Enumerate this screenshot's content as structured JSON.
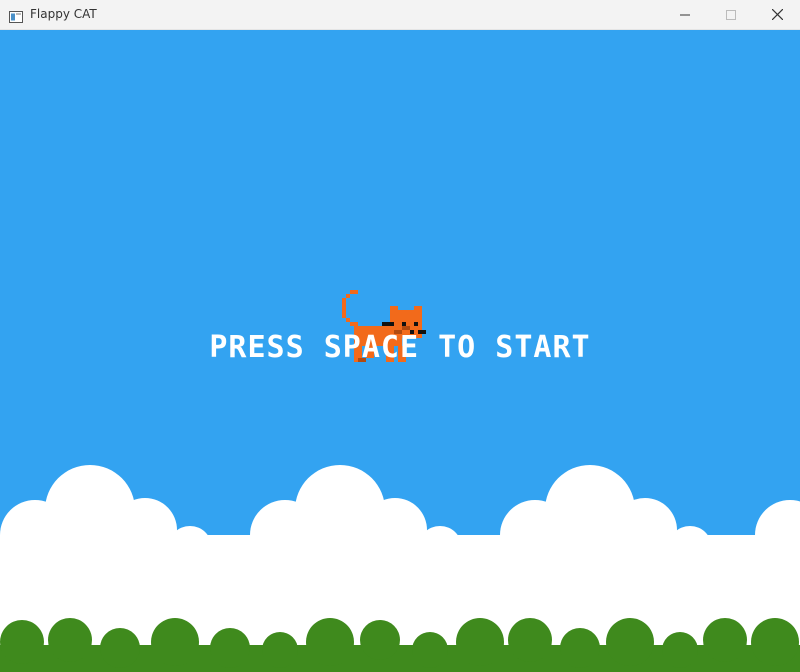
{
  "window": {
    "title": "Flappy CAT",
    "controls": [
      "minimize",
      "maximize",
      "close"
    ]
  },
  "game": {
    "prompt": "PRESS SPACE TO START",
    "sky_color": "#33a3f1",
    "cloud_color": "#ffffff",
    "bush_color": "#3f8a1d",
    "cat_color": "#f26a1b",
    "player": "cat-icon"
  }
}
